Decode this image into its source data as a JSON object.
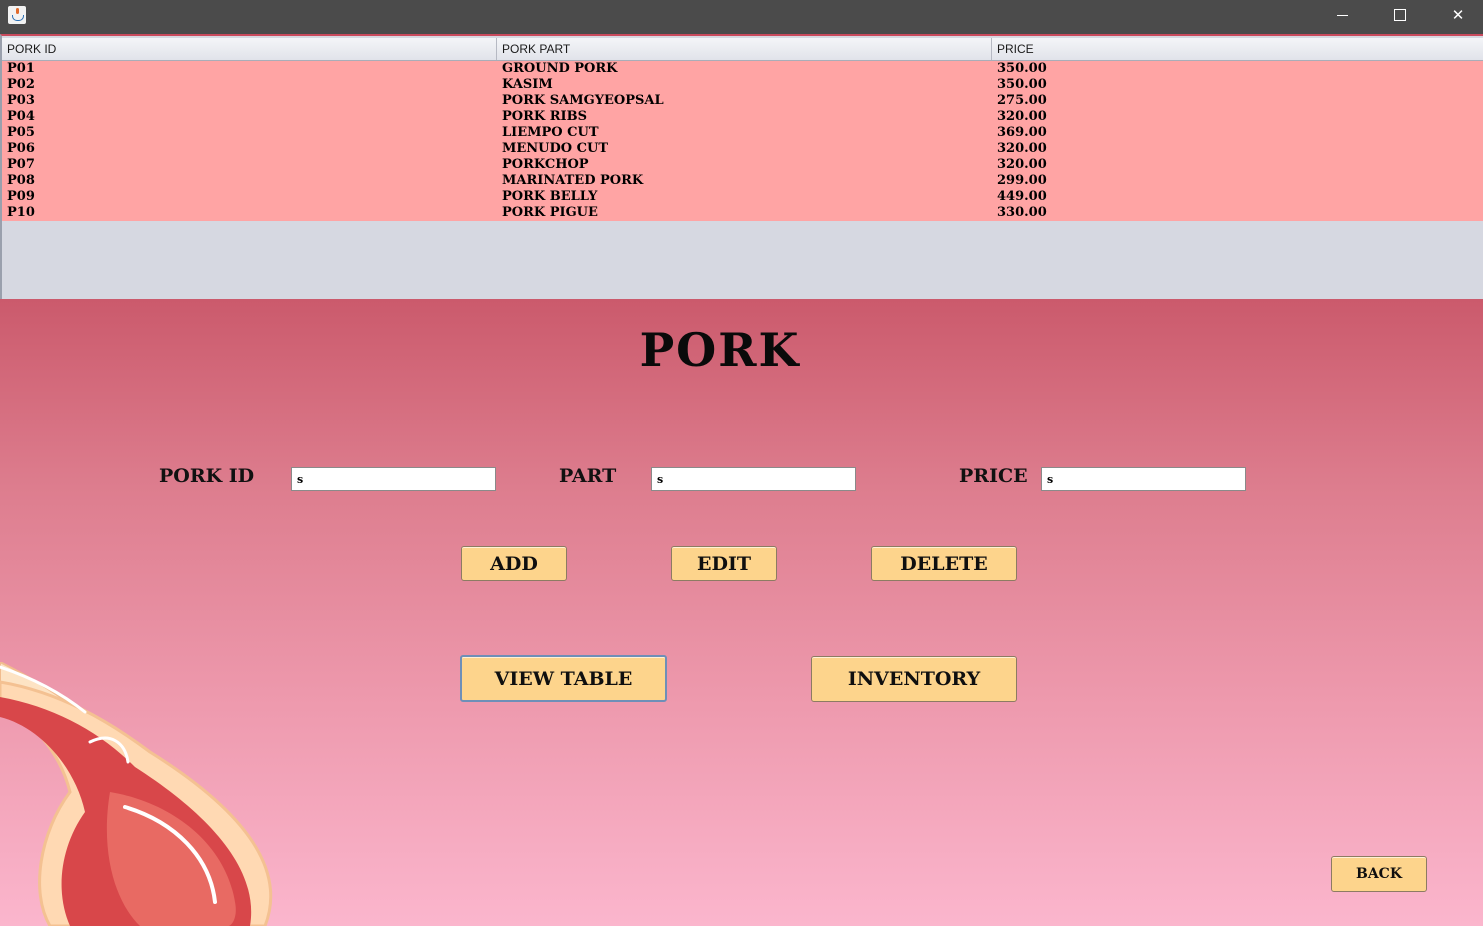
{
  "window": {
    "minimize_glyph": "",
    "maximize_glyph": "",
    "close_glyph": "✕"
  },
  "table": {
    "headers": [
      "PORK ID",
      "PORK PART",
      "PRICE"
    ],
    "rows": [
      [
        "P01",
        "GROUND PORK",
        "350.00"
      ],
      [
        "P02",
        "KASIM",
        "350.00"
      ],
      [
        "P03",
        "PORK SAMGYEOPSAL",
        "275.00"
      ],
      [
        "P04",
        "PORK RIBS",
        "320.00"
      ],
      [
        "P05",
        "LIEMPO CUT",
        "369.00"
      ],
      [
        "P06",
        "MENUDO CUT",
        "320.00"
      ],
      [
        "P07",
        "PORKCHOP",
        "320.00"
      ],
      [
        "P08",
        "MARINATED PORK",
        "299.00"
      ],
      [
        "P09",
        "PORK BELLY",
        "449.00"
      ],
      [
        "P10",
        "PORK PIGUE",
        "330.00"
      ]
    ]
  },
  "form": {
    "title": "PORK",
    "pork_id_label": "PORK ID",
    "pork_id_value": "s",
    "part_label": "PART",
    "part_value": "s",
    "price_label": "PRICE",
    "price_value": "s"
  },
  "buttons": {
    "add": "ADD",
    "edit": "EDIT",
    "delete": "DELETE",
    "view_table": "VIEW TABLE",
    "inventory": "INVENTORY",
    "back": "BACK"
  },
  "colors": {
    "table_rows_bg": "#ffa4a4",
    "button_bg": "#fdd48c",
    "panel_top": "#cb5a6c",
    "panel_bottom": "#fbb6cd"
  }
}
